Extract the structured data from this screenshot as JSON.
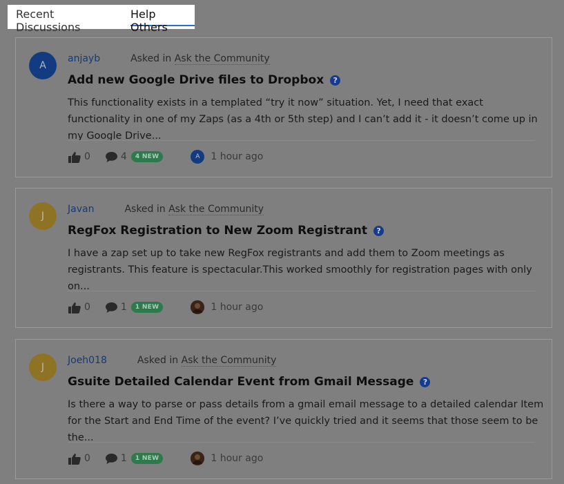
{
  "tabs": {
    "recent": "Recent Discussions",
    "help": "Help Others"
  },
  "posts": [
    {
      "avatar_letter": "A",
      "avatar_color": "#123b80",
      "author": "anjayb",
      "asked_prefix": "Asked in",
      "community": "Ask the Community",
      "title": "Add new Google Drive files to Dropbox",
      "question_icon": "?",
      "excerpt": "This functionality exists in a templated “try it now” situation. Yet, I need that exact functionality in one of my Zaps (as a 4th or 5th step) and I can’t add it - it doesn’t come up in my Google Drive...",
      "likes": "0",
      "comments": "4",
      "new_badge": "4 NEW",
      "replier_letter": "A",
      "replier_color": "#123b80",
      "time": "1 hour ago"
    },
    {
      "avatar_letter": "J",
      "avatar_color": "#8f7325",
      "author": "Javan",
      "asked_prefix": "Asked in",
      "community": "Ask the Community",
      "title": "RegFox Registration to New Zoom Registrant",
      "question_icon": "?",
      "excerpt": "I have a zap set up to take new RegFox registrants and add them to Zoom meetings as registrants. This feature is spectacular.This worked smoothly for registration pages with only on...",
      "likes": "0",
      "comments": "1",
      "new_badge": "1 NEW",
      "replier_letter": "",
      "replier_color": "#3a2418",
      "time": "1 hour ago"
    },
    {
      "avatar_letter": "J",
      "avatar_color": "#8f7325",
      "author": "Joeh018",
      "asked_prefix": "Asked in",
      "community": "Ask the Community",
      "title": "Gsuite Detailed Calendar Event from Gmail Message",
      "question_icon": "?",
      "excerpt": "Is there a way to parse or pass details from a gmail email message to a detailed calendar Item for the Start and  End Time of the event? I’ve quickly tried and it seems that those seem to be the...",
      "likes": "0",
      "comments": "1",
      "new_badge": "1 NEW",
      "replier_letter": "",
      "replier_color": "#3a2418",
      "time": "1 hour ago"
    }
  ]
}
